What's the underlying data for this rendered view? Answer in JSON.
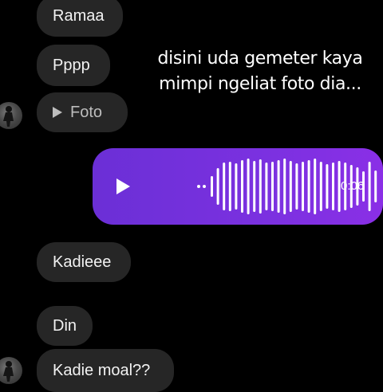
{
  "colors": {
    "background": "#000000",
    "bubble": "#262626",
    "voice_gradient_start": "#6b2fd6",
    "voice_gradient_end": "#8a2fe6"
  },
  "messages": [
    {
      "text": "Ramaa"
    },
    {
      "text": "Pppp"
    },
    {
      "text": "Foto",
      "icon": "play-icon"
    },
    {
      "text": "Kadieee"
    },
    {
      "text": "Din"
    },
    {
      "text": "Kadie moal??"
    }
  ],
  "caption": {
    "line1": "disini uda gemeter kaya",
    "line2": "mimpi ngeliat foto dia..."
  },
  "voice_message": {
    "duration": "0:06",
    "icon": "play-icon"
  }
}
